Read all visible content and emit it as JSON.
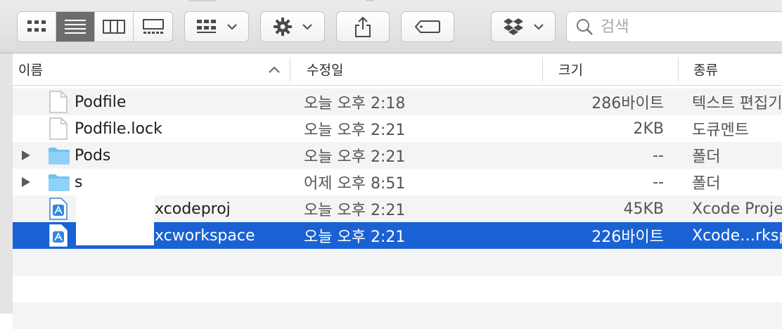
{
  "toolbar": {
    "view_modes": [
      {
        "id": "icon",
        "icon": "grid-icon"
      },
      {
        "id": "list",
        "icon": "list-icon",
        "active": true
      },
      {
        "id": "column",
        "icon": "columns-icon"
      },
      {
        "id": "gallery",
        "icon": "gallery-icon"
      }
    ],
    "search_placeholder": "검색"
  },
  "columns": {
    "name": "이름",
    "date": "수정일",
    "size": "크기",
    "kind": "종류"
  },
  "files": [
    {
      "name": "Podfile",
      "date": "오늘 오후 2:18",
      "size": "286바이트",
      "kind": "텍스트 편집기",
      "icon": "document-icon"
    },
    {
      "name": "Podfile.lock",
      "date": "오늘 오후 2:21",
      "size": "2KB",
      "kind": "도큐멘트",
      "icon": "document-icon"
    },
    {
      "name": "Pods",
      "date": "오늘 오후 2:21",
      "size": "--",
      "kind": "폴더",
      "icon": "folder-icon"
    },
    {
      "name": "s",
      "date": "어제 오후 8:51",
      "size": "--",
      "kind": "폴더",
      "icon": "folder-icon"
    },
    {
      "name": "xcodeproj",
      "date": "오늘 오후 2:21",
      "size": "45KB",
      "kind": "Xcode Proje",
      "icon": "xcode-project-icon"
    },
    {
      "name": "xcworkspace",
      "date": "오늘 오후 2:21",
      "size": "226바이트",
      "kind": "Xcode…rksp",
      "icon": "xcode-project-icon",
      "selected": true
    }
  ],
  "colors": {
    "selection": "#1a62d4",
    "folder": "#6cc3f5"
  }
}
